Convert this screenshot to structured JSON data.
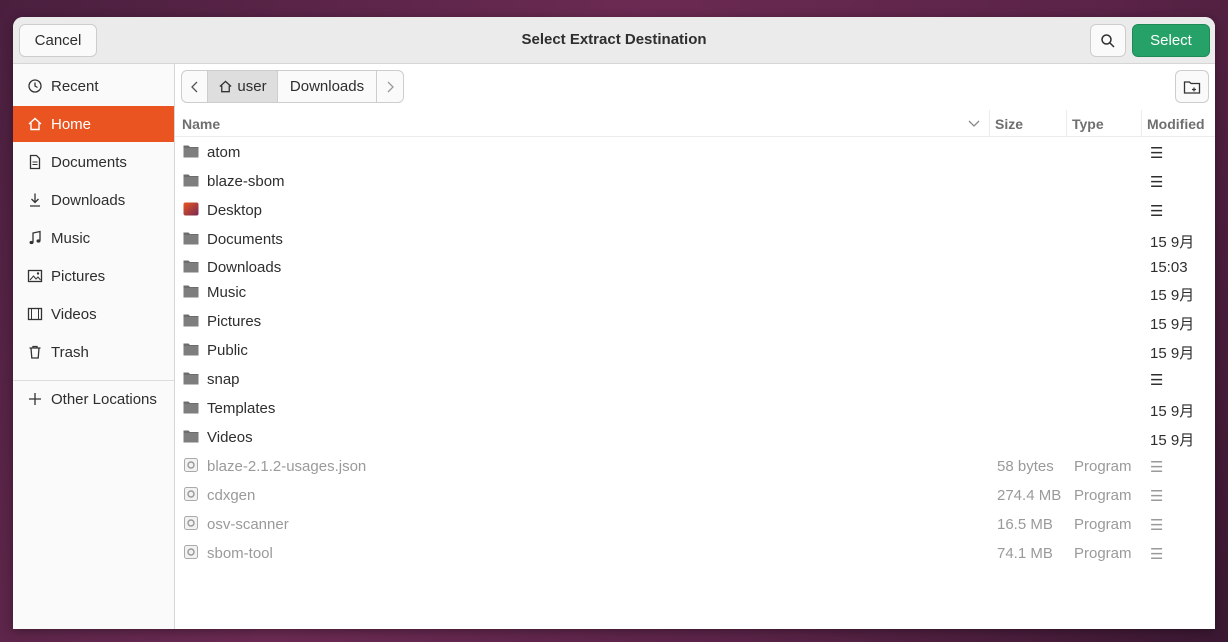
{
  "header": {
    "title": "Select Extract Destination",
    "cancel_label": "Cancel",
    "select_label": "Select",
    "search_icon": "search-icon"
  },
  "sidebar": {
    "items": [
      {
        "label": "Recent",
        "icon": "clock-icon"
      },
      {
        "label": "Home",
        "icon": "home-icon",
        "active": true
      },
      {
        "label": "Documents",
        "icon": "document-icon"
      },
      {
        "label": "Downloads",
        "icon": "download-icon"
      },
      {
        "label": "Music",
        "icon": "music-icon"
      },
      {
        "label": "Pictures",
        "icon": "picture-icon"
      },
      {
        "label": "Videos",
        "icon": "video-icon"
      },
      {
        "label": "Trash",
        "icon": "trash-icon"
      }
    ],
    "other_locations": "Other Locations"
  },
  "pathbar": {
    "back_icon": "chevron-left-icon",
    "home_label": "user",
    "current": "Downloads",
    "forward_icon": "chevron-right-icon"
  },
  "columns": {
    "name": "Name",
    "size": "Size",
    "type": "Type",
    "modified": "Modified"
  },
  "files": [
    {
      "name": "atom",
      "size": "",
      "type": "",
      "modified": "☰",
      "kind": "folder"
    },
    {
      "name": "blaze-sbom",
      "size": "",
      "type": "",
      "modified": "☰",
      "kind": "folder"
    },
    {
      "name": "Desktop",
      "size": "",
      "type": "",
      "modified": "☰",
      "kind": "desktop"
    },
    {
      "name": "Documents",
      "size": "",
      "type": "",
      "modified": "15 9月",
      "kind": "folder"
    },
    {
      "name": "Downloads",
      "size": "",
      "type": "",
      "modified": "15:03",
      "kind": "folder"
    },
    {
      "name": "Music",
      "size": "",
      "type": "",
      "modified": "15 9月",
      "kind": "folder"
    },
    {
      "name": "Pictures",
      "size": "",
      "type": "",
      "modified": "15 9月",
      "kind": "folder"
    },
    {
      "name": "Public",
      "size": "",
      "type": "",
      "modified": "15 9月",
      "kind": "folder"
    },
    {
      "name": "snap",
      "size": "",
      "type": "",
      "modified": "☰",
      "kind": "folder"
    },
    {
      "name": "Templates",
      "size": "",
      "type": "",
      "modified": "15 9月",
      "kind": "folder"
    },
    {
      "name": "Videos",
      "size": "",
      "type": "",
      "modified": "15 9月",
      "kind": "folder"
    },
    {
      "name": "blaze-2.1.2-usages.json",
      "size": "58 bytes",
      "type": "Program",
      "modified": "☰",
      "kind": "file"
    },
    {
      "name": "cdxgen",
      "size": "274.4 MB",
      "type": "Program",
      "modified": "☰",
      "kind": "file"
    },
    {
      "name": "osv-scanner",
      "size": "16.5 MB",
      "type": "Program",
      "modified": "☰",
      "kind": "file"
    },
    {
      "name": "sbom-tool",
      "size": "74.1 MB",
      "type": "Program",
      "modified": "☰",
      "kind": "file"
    }
  ],
  "colors": {
    "accent": "#e95420",
    "select": "#26a269",
    "folder": "#6d6d6d"
  }
}
